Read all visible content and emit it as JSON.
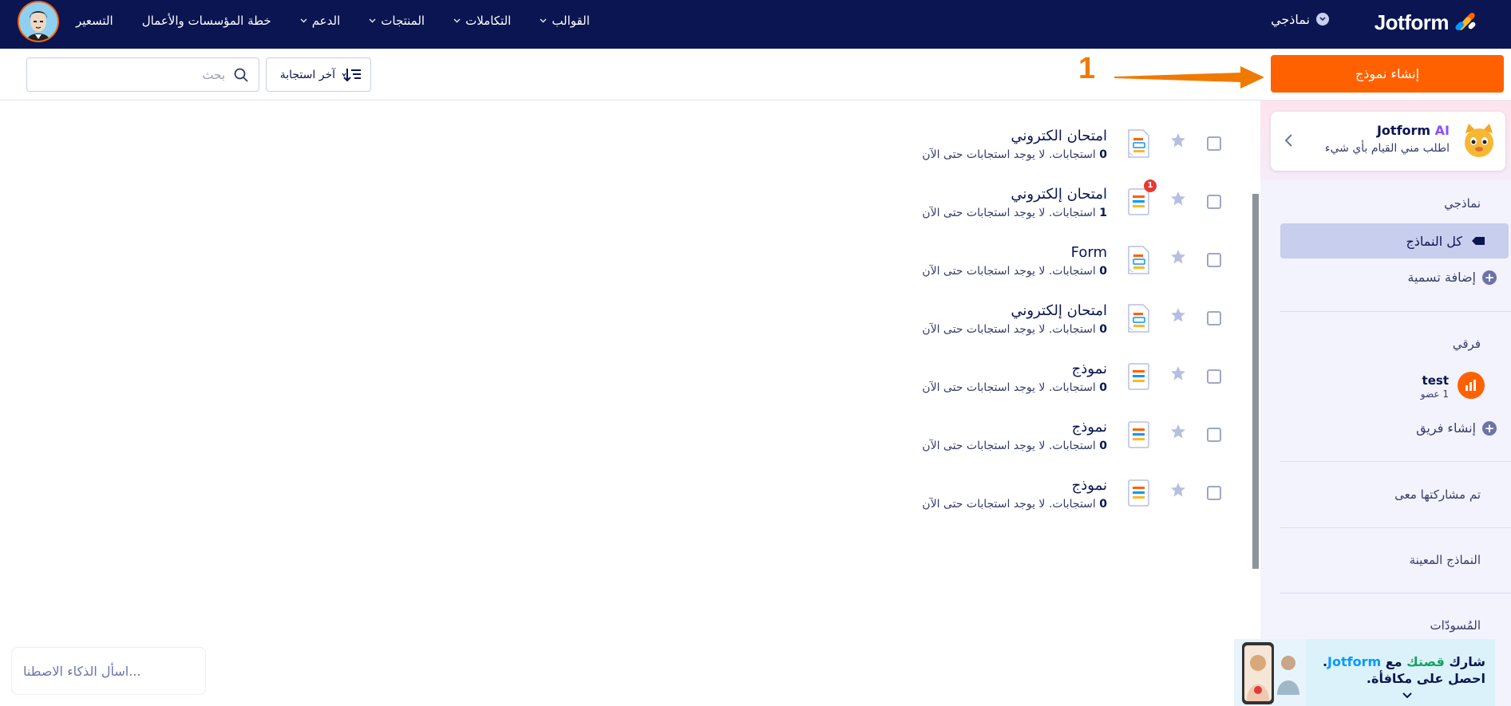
{
  "topnav": {
    "brand": "Jotform",
    "my_forms": "نماذجي",
    "links": [
      {
        "label": "القوالب",
        "caret": true
      },
      {
        "label": "التكاملات",
        "caret": true
      },
      {
        "label": "المنتجات",
        "caret": true
      },
      {
        "label": "الدعم",
        "caret": true
      },
      {
        "label": "خطة المؤسسات والأعمال",
        "caret": false
      },
      {
        "label": "التسعير",
        "caret": false
      }
    ]
  },
  "toolbar": {
    "create_label": "إنشاء نموذج",
    "annotation_number": "1",
    "sort_label": "آخر استجابة",
    "search_placeholder": "بحث"
  },
  "sidebar": {
    "ai_card": {
      "title_brand": "Jotform",
      "title_ai": "AI",
      "subtitle": "اطلب مني القيام بأي شيء"
    },
    "my_forms_heading": "نماذجي",
    "all_forms": "كل النماذج",
    "add_label": "إضافة تسمية",
    "my_teams_heading": "فرقي",
    "team": {
      "name": "test",
      "members": "1 عضو"
    },
    "create_team": "إنشاء فريق",
    "shared": "تم مشاركتها معى",
    "assigned": "النماذج المعينة",
    "drafts": "المُسودّات"
  },
  "promo": {
    "part1": "شارك ",
    "part2": "قصتك",
    "part3": " مع ",
    "part4": "Jotform",
    "part5": ".",
    "line2": "احصل على مكافأة."
  },
  "forms": [
    {
      "title": "امتحان الكتروني",
      "count": "0",
      "sub": " استجابات. لا يوجد استجابات حتى الآن",
      "icon": "exam",
      "badge": ""
    },
    {
      "title": "امتحان إلكتروني",
      "count": "1",
      "sub": " استجابات. لا يوجد استجابات حتى الآن",
      "icon": "form",
      "badge": "1"
    },
    {
      "title": "Form",
      "count": "0",
      "sub": " استجابات. لا يوجد استجابات حتى الآن",
      "icon": "exam",
      "badge": ""
    },
    {
      "title": "امتحان إلكتروني",
      "count": "0",
      "sub": " استجابات. لا يوجد استجابات حتى الآن",
      "icon": "exam",
      "badge": ""
    },
    {
      "title": "نموذج",
      "count": "0",
      "sub": " استجابات. لا يوجد استجابات حتى الآن",
      "icon": "form",
      "badge": ""
    },
    {
      "title": "نموذج",
      "count": "0",
      "sub": " استجابات. لا يوجد استجابات حتى الآن",
      "icon": "form",
      "badge": ""
    },
    {
      "title": "نموذج",
      "count": "0",
      "sub": " استجابات. لا يوجد استجابات حتى الآن",
      "icon": "form",
      "badge": ""
    }
  ],
  "ai_ask_placeholder": "اسأل الذكاء الاصطنا...",
  "colors": {
    "nav_bg": "#0a1551",
    "accent": "#ff6100",
    "active_item": "#c8ceed",
    "sidebar_bg": "#f3f3fe"
  }
}
